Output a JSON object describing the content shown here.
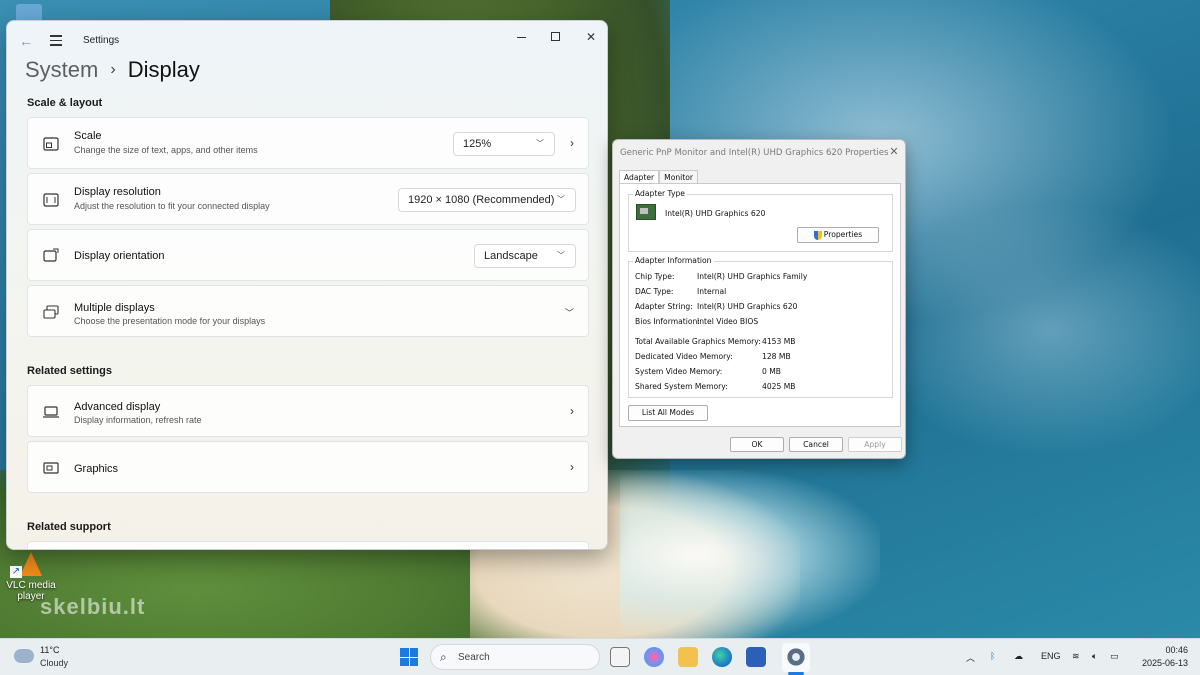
{
  "settings": {
    "app_title": "Settings",
    "breadcrumb": {
      "parent": "System",
      "separator": "›",
      "current": "Display"
    },
    "sections": {
      "scale_layout": "Scale & layout",
      "related_settings": "Related settings",
      "related_support": "Related support"
    },
    "scale": {
      "title": "Scale",
      "subtitle": "Change the size of text, apps, and other items",
      "value": "125%"
    },
    "resolution": {
      "title": "Display resolution",
      "subtitle": "Adjust the resolution to fit your connected display",
      "value": "1920 × 1080 (Recommended)"
    },
    "orientation": {
      "title": "Display orientation",
      "value": "Landscape"
    },
    "multiple": {
      "title": "Multiple displays",
      "subtitle": "Choose the presentation mode for your displays"
    },
    "advanced": {
      "title": "Advanced display",
      "subtitle": "Display information, refresh rate"
    },
    "graphics": {
      "title": "Graphics"
    }
  },
  "dialog": {
    "title": "Generic PnP Monitor and Intel(R) UHD Graphics 620 Properties",
    "tabs": [
      "Adapter",
      "Monitor"
    ],
    "adapter_type_label": "Adapter Type",
    "adapter_name": "Intel(R) UHD Graphics 620",
    "properties_button": "Properties",
    "adapter_info_label": "Adapter Information",
    "info": [
      {
        "key": "Chip Type:",
        "value": "Intel(R) UHD Graphics Family"
      },
      {
        "key": "DAC Type:",
        "value": "Internal"
      },
      {
        "key": "Adapter String:",
        "value": "Intel(R) UHD Graphics 620"
      },
      {
        "key": "Bios Information:",
        "value": "Intel Video BIOS"
      }
    ],
    "memory": [
      {
        "key": "Total Available Graphics Memory:",
        "value": "4153 MB"
      },
      {
        "key": "Dedicated Video Memory:",
        "value": "128 MB"
      },
      {
        "key": "System Video Memory:",
        "value": "0 MB"
      },
      {
        "key": "Shared System Memory:",
        "value": "4025 MB"
      }
    ],
    "list_modes_button": "List All Modes",
    "ok": "OK",
    "cancel": "Cancel",
    "apply": "Apply"
  },
  "desktop": {
    "vlc_label": "VLC media player",
    "watermark": "skelbiu.lt"
  },
  "taskbar": {
    "weather_temp": "11°C",
    "weather_cond": "Cloudy",
    "search_label": "Search",
    "language": "ENG",
    "time": "00:46",
    "date": "2025-06-13",
    "accent": "#1b7be0"
  }
}
